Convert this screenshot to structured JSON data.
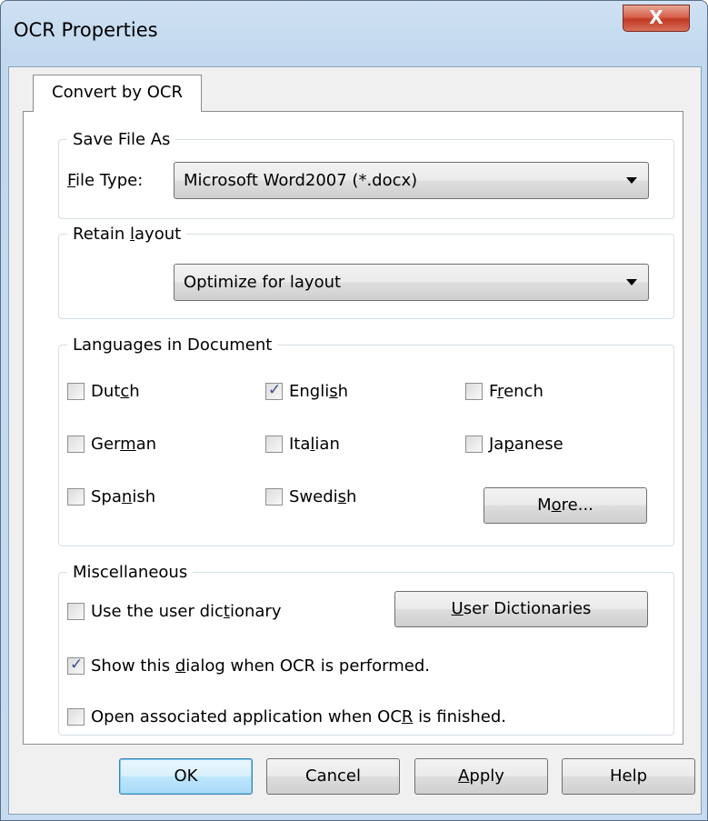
{
  "window": {
    "title": "OCR Properties",
    "close_label": "X"
  },
  "tab": {
    "label": "Convert by OCR"
  },
  "save_group": {
    "legend": "Save File As",
    "file_type_label_pre": "F",
    "file_type_label_post": "ile Type:",
    "file_type_value": "Microsoft Word2007 (*.docx)"
  },
  "layout_group": {
    "legend_pre": "Retain ",
    "legend_u": "l",
    "legend_post": "ayout",
    "value": "Optimize for layout"
  },
  "lang_group": {
    "legend": "Languages in Document",
    "languages": [
      {
        "pre": "Dut",
        "u": "c",
        "post": "h",
        "checked": false
      },
      {
        "pre": "Engli",
        "u": "s",
        "post": "h",
        "checked": true
      },
      {
        "pre": "F",
        "u": "r",
        "post": "ench",
        "checked": false
      },
      {
        "pre": "Ger",
        "u": "m",
        "post": "an",
        "checked": false
      },
      {
        "pre": "Ita",
        "u": "l",
        "post": "ian",
        "checked": false
      },
      {
        "pre": "Ja",
        "u": "p",
        "post": "anese",
        "checked": false
      },
      {
        "pre": "Spa",
        "u": "n",
        "post": "ish",
        "checked": false
      },
      {
        "pre": "Swedi",
        "u": "s",
        "post": "h",
        "checked": false
      }
    ],
    "more_pre": "M",
    "more_u": "o",
    "more_post": "re..."
  },
  "misc_group": {
    "legend": "Miscellaneous",
    "user_dict": {
      "pre": "Use the user dic",
      "u": "t",
      "post": "ionary",
      "checked": false
    },
    "user_dict_button": {
      "u": "U",
      "post": "ser Dictionaries"
    },
    "show_dialog": {
      "pre": "Show this ",
      "u": "d",
      "post": "ialog when OCR is performed.",
      "checked": true
    },
    "open_app": {
      "pre": "Open associated application when OC",
      "u": "R",
      "post": " is finished.",
      "checked": false
    }
  },
  "buttons": {
    "ok": "OK",
    "cancel": "Cancel",
    "apply_u": "A",
    "apply_post": "pply",
    "help": "Help"
  }
}
